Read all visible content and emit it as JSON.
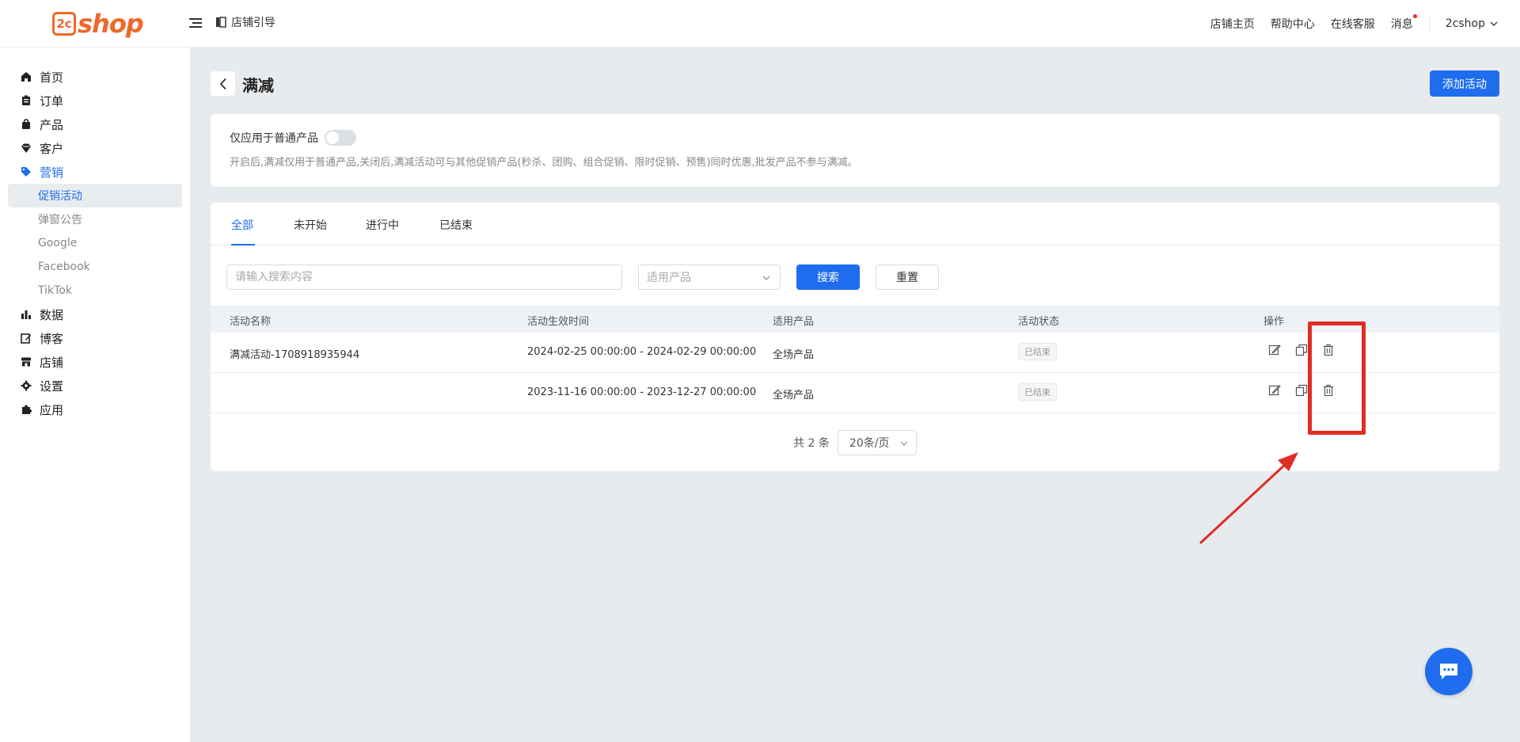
{
  "header": {
    "logo": "2cshop",
    "guide_label": "店铺引导",
    "links": [
      "店铺主页",
      "帮助中心",
      "在线客服",
      "消息"
    ],
    "user": "2cshop"
  },
  "sidebar": {
    "items": [
      {
        "label": "首页",
        "icon": "home-icon"
      },
      {
        "label": "订单",
        "icon": "clipboard-icon"
      },
      {
        "label": "产品",
        "icon": "bag-icon"
      },
      {
        "label": "客户",
        "icon": "diamond-icon"
      },
      {
        "label": "营销",
        "icon": "tag-icon"
      },
      {
        "label": "数据",
        "icon": "bar-chart-icon"
      },
      {
        "label": "博客",
        "icon": "edit-icon"
      },
      {
        "label": "店铺",
        "icon": "store-icon"
      },
      {
        "label": "设置",
        "icon": "gear-icon"
      },
      {
        "label": "应用",
        "icon": "puzzle-icon"
      }
    ],
    "marketing_sub": [
      "促销活动",
      "弹窗公告",
      "Google",
      "Facebook",
      "TikTok"
    ]
  },
  "page": {
    "title": "满减",
    "add_button": "添加活动",
    "toggle_label": "仅应用于普通产品",
    "hint": "开启后,满减仅用于普通产品,关闭后,满减活动可与其他促销产品(秒杀、团购、组合促销、限时促销、预售)同时优惠,批发产品不参与满减。"
  },
  "tabs": [
    "全部",
    "未开始",
    "进行中",
    "已结束"
  ],
  "filters": {
    "search_placeholder": "请输入搜索内容",
    "product_placeholder": "适用产品",
    "search_button": "搜索",
    "reset_button": "重置"
  },
  "table": {
    "columns": [
      "活动名称",
      "活动生效时间",
      "适用产品",
      "活动状态",
      "操作"
    ],
    "rows": [
      {
        "name": "满减活动-1708918935944",
        "time": "2024-02-25 00:00:00 - 2024-02-29 00:00:00",
        "product": "全场产品",
        "status": "已结束"
      },
      {
        "name": "",
        "time": "2023-11-16 00:00:00 - 2023-12-27 00:00:00",
        "product": "全场产品",
        "status": "已结束"
      }
    ]
  },
  "pagination": {
    "total": "共 2 条",
    "page_size": "20条/页"
  },
  "colors": {
    "brand": "#f0672a",
    "primary": "#1f6dee",
    "annotation": "#e02c24"
  }
}
